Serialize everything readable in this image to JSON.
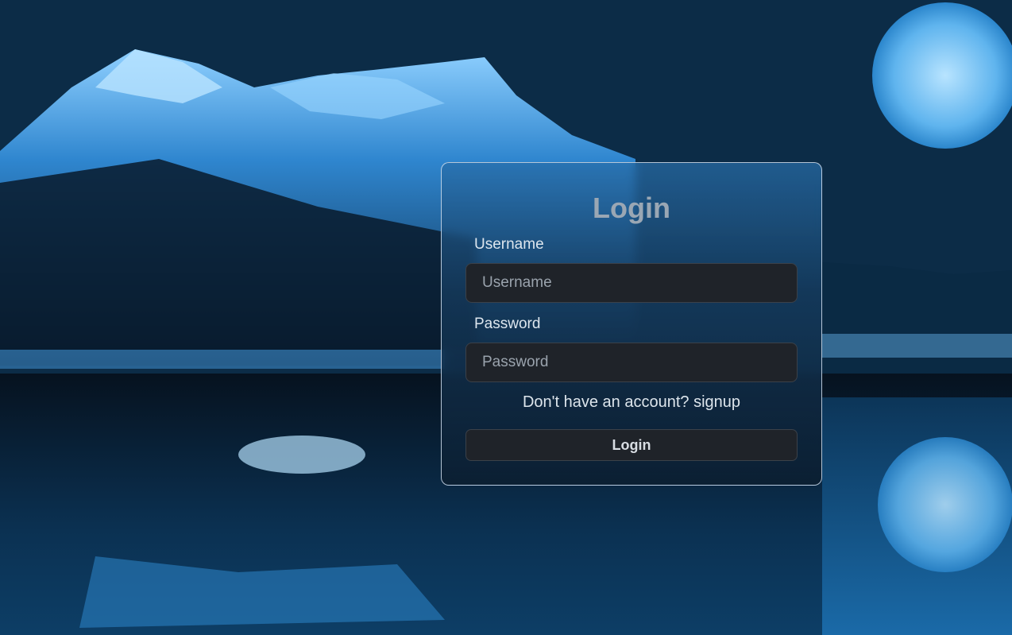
{
  "login_form": {
    "title": "Login",
    "username_label": "Username",
    "username_placeholder": "Username",
    "username_value": "",
    "password_label": "Password",
    "password_placeholder": "Password",
    "password_value": "",
    "signup_prompt": "Don't have an account?",
    "signup_link": "signup",
    "submit_label": "Login"
  },
  "colors": {
    "background": "#0c2c47",
    "card_border": "#d2e1f0",
    "input_background": "#1f2329",
    "title_text": "#9aa7b4"
  }
}
